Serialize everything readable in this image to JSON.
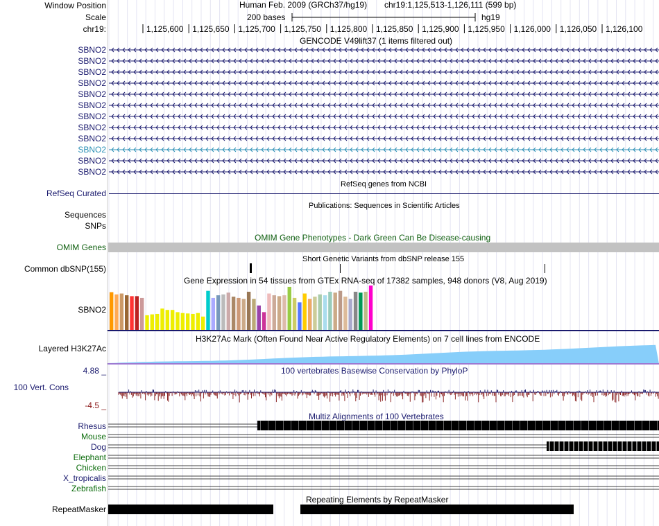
{
  "labels": {
    "window_position": "Window Position",
    "scale": "Scale",
    "chrom": "chr19:",
    "refseq": "RefSeq Curated",
    "sequences": "Sequences",
    "snps": "SNPs",
    "omim": "OMIM Genes",
    "dbsnp": "Common dbSNP(155)",
    "gtex_gene": "SBNO2",
    "h3k27ac": "Layered H3K27Ac",
    "phylop_max": "4.88 _",
    "phylop_name": "100 Vert. Cons",
    "phylop_min": "-4.5 _",
    "repeatmasker": "RepeatMasker"
  },
  "position": {
    "assembly": "Human Feb. 2009 (GRCh37/hg19)",
    "range": "chr19:1,125,513-1,126,111 (599 bp)",
    "scale_label": "200 bases",
    "db": "hg19"
  },
  "ruler_ticks": [
    "1,125,600",
    "1,125,650",
    "1,125,700",
    "1,125,750",
    "1,125,800",
    "1,125,850",
    "1,125,900",
    "1,125,950",
    "1,126,000",
    "1,126,050",
    "1,126,100"
  ],
  "gencode": {
    "title": "GENCODE V49lift37 (1 items filtered out)",
    "transcripts": [
      {
        "label": "SBNO2",
        "color": "#1a1a6e"
      },
      {
        "label": "SBNO2",
        "color": "#1a1a6e"
      },
      {
        "label": "SBNO2",
        "color": "#1a1a6e"
      },
      {
        "label": "SBNO2",
        "color": "#1a1a6e"
      },
      {
        "label": "SBNO2",
        "color": "#1a1a6e"
      },
      {
        "label": "SBNO2",
        "color": "#1a1a6e"
      },
      {
        "label": "SBNO2",
        "color": "#1a1a6e"
      },
      {
        "label": "SBNO2",
        "color": "#1a1a6e"
      },
      {
        "label": "SBNO2",
        "color": "#1a1a6e"
      },
      {
        "label": "SBNO2",
        "color": "#2a8fb5"
      },
      {
        "label": "SBNO2",
        "color": "#1a1a6e"
      },
      {
        "label": "SBNO2",
        "color": "#1a1a6e"
      }
    ]
  },
  "titles": {
    "refseq": "RefSeq genes from NCBI",
    "publications": "Publications: Sequences in Scientific Articles",
    "omim": "OMIM Gene Phenotypes - Dark Green Can Be Disease-causing",
    "dbsnp": "Short Genetic Variants from dbSNP release 155",
    "gtex": "Gene Expression in 54 tissues from GTEx RNA-seq of 17382 samples, 948 donors (V8, Aug 2019)",
    "h3k27ac": "H3K27Ac Mark (Often Found Near Active Regulatory Elements) on 7 cell lines from ENCODE",
    "phylop": "100 vertebrates Basewise Conservation by PhyloP",
    "multiz": "Multiz Alignments of 100 Vertebrates",
    "repeatmasker": "Repeating Elements by RepeatMasker"
  },
  "species": [
    {
      "name": "Rhesus",
      "color": "#1a1a6e"
    },
    {
      "name": "Mouse",
      "color": "#0b6b0b"
    },
    {
      "name": "Dog",
      "color": "#1a1a6e"
    },
    {
      "name": "Elephant",
      "color": "#0b6b0b"
    },
    {
      "name": "Chicken",
      "color": "#0b6b0b"
    },
    {
      "name": "X_tropicalis",
      "color": "#1a1a6e"
    },
    {
      "name": "Zebrafish",
      "color": "#0b6b0b"
    }
  ],
  "gtex_bars": [
    {
      "v": 0.85,
      "c": "#ff9900"
    },
    {
      "v": 0.8,
      "c": "#ffaa55"
    },
    {
      "v": 0.82,
      "c": "#cc9966"
    },
    {
      "v": 0.78,
      "c": "#996633"
    },
    {
      "v": 0.76,
      "c": "#ff3333"
    },
    {
      "v": 0.76,
      "c": "#bb2222"
    },
    {
      "v": 0.72,
      "c": "#cc9999"
    },
    {
      "v": 0.33,
      "c": "#eeee00"
    },
    {
      "v": 0.35,
      "c": "#eeee00"
    },
    {
      "v": 0.36,
      "c": "#eeee00"
    },
    {
      "v": 0.48,
      "c": "#eeee00"
    },
    {
      "v": 0.45,
      "c": "#eeee00"
    },
    {
      "v": 0.45,
      "c": "#eeee00"
    },
    {
      "v": 0.4,
      "c": "#eeee00"
    },
    {
      "v": 0.38,
      "c": "#eeee00"
    },
    {
      "v": 0.37,
      "c": "#eeee00"
    },
    {
      "v": 0.36,
      "c": "#eeee00"
    },
    {
      "v": 0.38,
      "c": "#eeee00"
    },
    {
      "v": 0.3,
      "c": "#eeee00"
    },
    {
      "v": 0.88,
      "c": "#00cccc"
    },
    {
      "v": 0.72,
      "c": "#aaaaff"
    },
    {
      "v": 0.78,
      "c": "#7799bb"
    },
    {
      "v": 0.8,
      "c": "#bbbbbb"
    },
    {
      "v": 0.84,
      "c": "#ccaaaa"
    },
    {
      "v": 0.75,
      "c": "#aa8866"
    },
    {
      "v": 0.72,
      "c": "#cc9977"
    },
    {
      "v": 0.7,
      "c": "#ccaa88"
    },
    {
      "v": 0.86,
      "c": "#997755"
    },
    {
      "v": 0.7,
      "c": "#bbaa77"
    },
    {
      "v": 0.55,
      "c": "#9944aa"
    },
    {
      "v": 0.4,
      "c": "#cc3399"
    },
    {
      "v": 0.82,
      "c": "#eebbbb"
    },
    {
      "v": 0.78,
      "c": "#ccaa99"
    },
    {
      "v": 0.76,
      "c": "#ccaa88"
    },
    {
      "v": 0.78,
      "c": "#ddbbaa"
    },
    {
      "v": 0.97,
      "c": "#99cc44"
    },
    {
      "v": 0.72,
      "c": "#cccc66"
    },
    {
      "v": 0.62,
      "c": "#5577ff"
    },
    {
      "v": 0.82,
      "c": "#ffcc00"
    },
    {
      "v": 0.7,
      "c": "#eeaa66"
    },
    {
      "v": 0.75,
      "c": "#cccc99"
    },
    {
      "v": 0.8,
      "c": "#aaccaa"
    },
    {
      "v": 0.78,
      "c": "#aaddee"
    },
    {
      "v": 0.86,
      "c": "#99ccbb"
    },
    {
      "v": 0.84,
      "c": "#ccaa88"
    },
    {
      "v": 0.88,
      "c": "#bb9988"
    },
    {
      "v": 0.75,
      "c": "#ddbb99"
    },
    {
      "v": 0.7,
      "c": "#aaaacc"
    },
    {
      "v": 0.86,
      "c": "#888888"
    },
    {
      "v": 0.84,
      "c": "#009955"
    },
    {
      "v": 0.86,
      "c": "#bbbb88"
    },
    {
      "v": 1.0,
      "c": "#ff00cc"
    }
  ]
}
